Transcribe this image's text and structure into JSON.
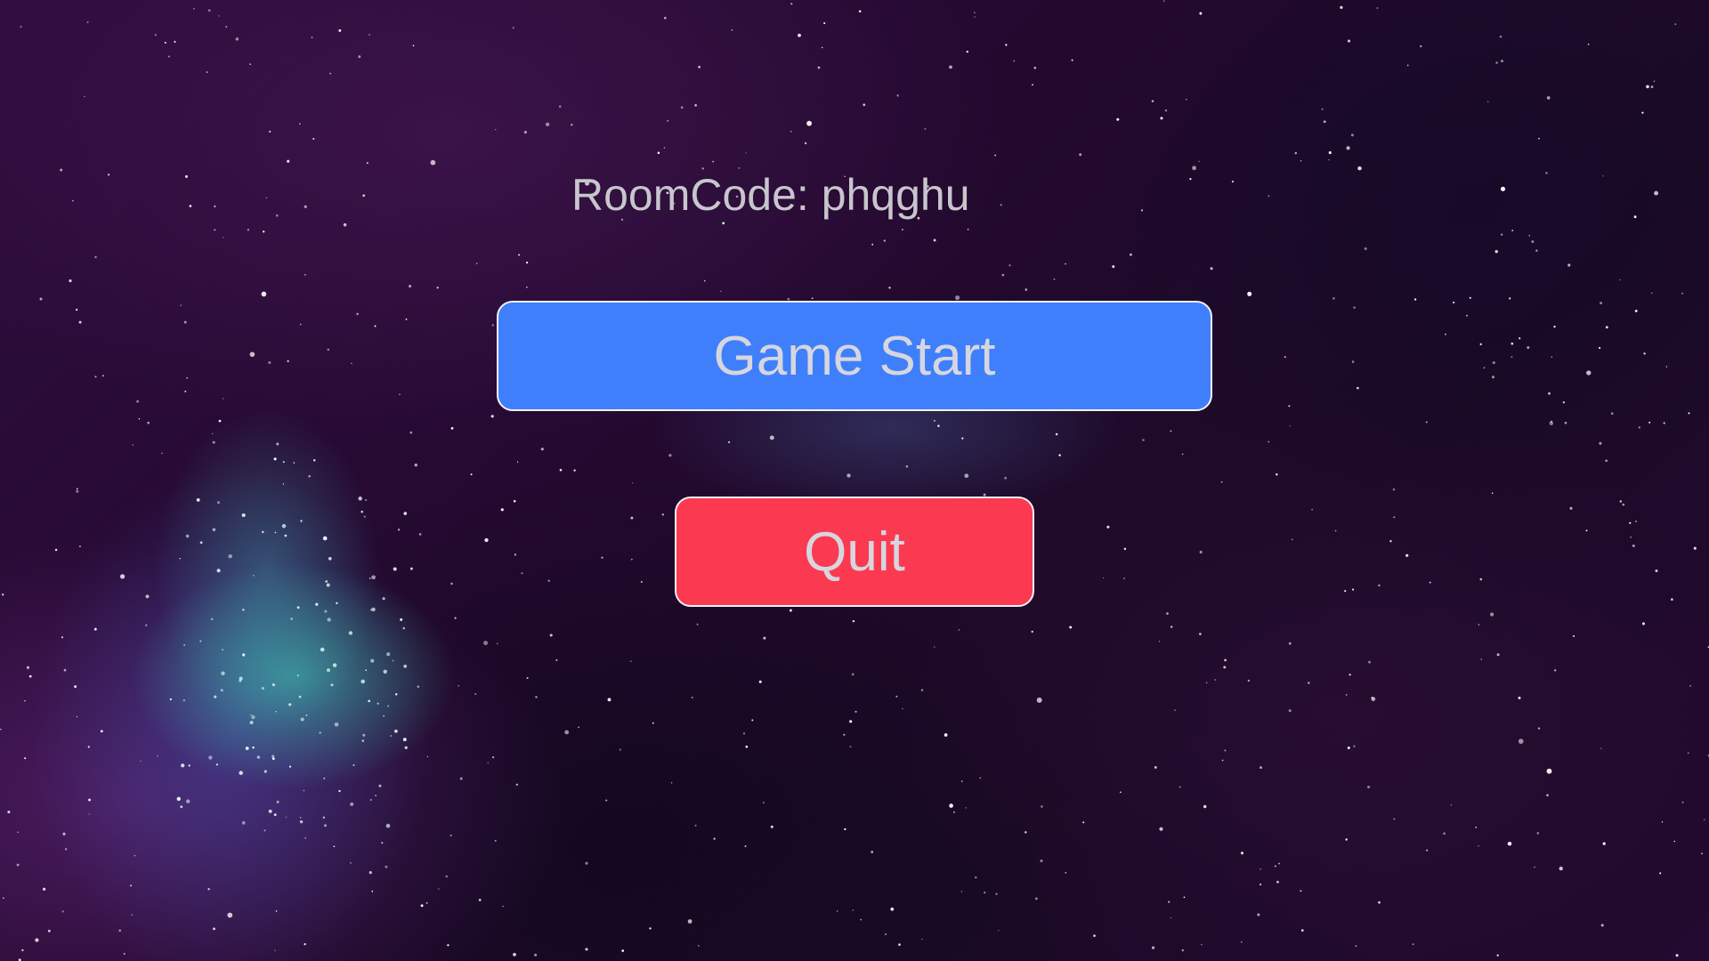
{
  "room_code": {
    "text": "RoomCode: phqghu"
  },
  "buttons": {
    "start_label": "Game Start",
    "quit_label": "Quit"
  },
  "colors": {
    "start_button": "#3f7ffb",
    "quit_button": "#fb3a52",
    "label_text": "#c7c5cd",
    "background": "#1a0a24"
  }
}
